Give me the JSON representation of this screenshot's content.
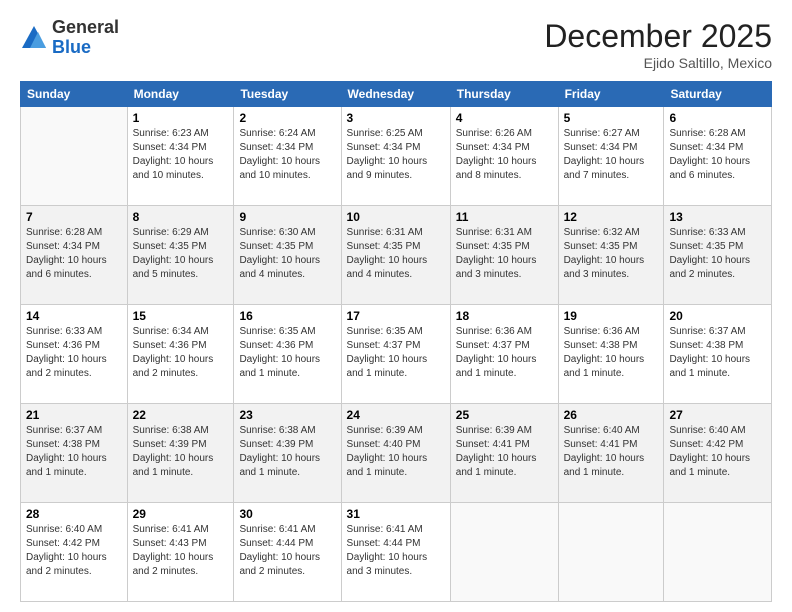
{
  "logo": {
    "general": "General",
    "blue": "Blue"
  },
  "header": {
    "month": "December 2025",
    "location": "Ejido Saltillo, Mexico"
  },
  "weekdays": [
    "Sunday",
    "Monday",
    "Tuesday",
    "Wednesday",
    "Thursday",
    "Friday",
    "Saturday"
  ],
  "weeks": [
    [
      {
        "day": "",
        "info": ""
      },
      {
        "day": "1",
        "info": "Sunrise: 6:23 AM\nSunset: 4:34 PM\nDaylight: 10 hours and 10 minutes."
      },
      {
        "day": "2",
        "info": "Sunrise: 6:24 AM\nSunset: 4:34 PM\nDaylight: 10 hours and 10 minutes."
      },
      {
        "day": "3",
        "info": "Sunrise: 6:25 AM\nSunset: 4:34 PM\nDaylight: 10 hours and 9 minutes."
      },
      {
        "day": "4",
        "info": "Sunrise: 6:26 AM\nSunset: 4:34 PM\nDaylight: 10 hours and 8 minutes."
      },
      {
        "day": "5",
        "info": "Sunrise: 6:27 AM\nSunset: 4:34 PM\nDaylight: 10 hours and 7 minutes."
      },
      {
        "day": "6",
        "info": "Sunrise: 6:28 AM\nSunset: 4:34 PM\nDaylight: 10 hours and 6 minutes."
      }
    ],
    [
      {
        "day": "7",
        "info": "Sunrise: 6:28 AM\nSunset: 4:34 PM\nDaylight: 10 hours and 6 minutes."
      },
      {
        "day": "8",
        "info": "Sunrise: 6:29 AM\nSunset: 4:35 PM\nDaylight: 10 hours and 5 minutes."
      },
      {
        "day": "9",
        "info": "Sunrise: 6:30 AM\nSunset: 4:35 PM\nDaylight: 10 hours and 4 minutes."
      },
      {
        "day": "10",
        "info": "Sunrise: 6:31 AM\nSunset: 4:35 PM\nDaylight: 10 hours and 4 minutes."
      },
      {
        "day": "11",
        "info": "Sunrise: 6:31 AM\nSunset: 4:35 PM\nDaylight: 10 hours and 3 minutes."
      },
      {
        "day": "12",
        "info": "Sunrise: 6:32 AM\nSunset: 4:35 PM\nDaylight: 10 hours and 3 minutes."
      },
      {
        "day": "13",
        "info": "Sunrise: 6:33 AM\nSunset: 4:35 PM\nDaylight: 10 hours and 2 minutes."
      }
    ],
    [
      {
        "day": "14",
        "info": "Sunrise: 6:33 AM\nSunset: 4:36 PM\nDaylight: 10 hours and 2 minutes."
      },
      {
        "day": "15",
        "info": "Sunrise: 6:34 AM\nSunset: 4:36 PM\nDaylight: 10 hours and 2 minutes."
      },
      {
        "day": "16",
        "info": "Sunrise: 6:35 AM\nSunset: 4:36 PM\nDaylight: 10 hours and 1 minute."
      },
      {
        "day": "17",
        "info": "Sunrise: 6:35 AM\nSunset: 4:37 PM\nDaylight: 10 hours and 1 minute."
      },
      {
        "day": "18",
        "info": "Sunrise: 6:36 AM\nSunset: 4:37 PM\nDaylight: 10 hours and 1 minute."
      },
      {
        "day": "19",
        "info": "Sunrise: 6:36 AM\nSunset: 4:38 PM\nDaylight: 10 hours and 1 minute."
      },
      {
        "day": "20",
        "info": "Sunrise: 6:37 AM\nSunset: 4:38 PM\nDaylight: 10 hours and 1 minute."
      }
    ],
    [
      {
        "day": "21",
        "info": "Sunrise: 6:37 AM\nSunset: 4:38 PM\nDaylight: 10 hours and 1 minute."
      },
      {
        "day": "22",
        "info": "Sunrise: 6:38 AM\nSunset: 4:39 PM\nDaylight: 10 hours and 1 minute."
      },
      {
        "day": "23",
        "info": "Sunrise: 6:38 AM\nSunset: 4:39 PM\nDaylight: 10 hours and 1 minute."
      },
      {
        "day": "24",
        "info": "Sunrise: 6:39 AM\nSunset: 4:40 PM\nDaylight: 10 hours and 1 minute."
      },
      {
        "day": "25",
        "info": "Sunrise: 6:39 AM\nSunset: 4:41 PM\nDaylight: 10 hours and 1 minute."
      },
      {
        "day": "26",
        "info": "Sunrise: 6:40 AM\nSunset: 4:41 PM\nDaylight: 10 hours and 1 minute."
      },
      {
        "day": "27",
        "info": "Sunrise: 6:40 AM\nSunset: 4:42 PM\nDaylight: 10 hours and 1 minute."
      }
    ],
    [
      {
        "day": "28",
        "info": "Sunrise: 6:40 AM\nSunset: 4:42 PM\nDaylight: 10 hours and 2 minutes."
      },
      {
        "day": "29",
        "info": "Sunrise: 6:41 AM\nSunset: 4:43 PM\nDaylight: 10 hours and 2 minutes."
      },
      {
        "day": "30",
        "info": "Sunrise: 6:41 AM\nSunset: 4:44 PM\nDaylight: 10 hours and 2 minutes."
      },
      {
        "day": "31",
        "info": "Sunrise: 6:41 AM\nSunset: 4:44 PM\nDaylight: 10 hours and 3 minutes."
      },
      {
        "day": "",
        "info": ""
      },
      {
        "day": "",
        "info": ""
      },
      {
        "day": "",
        "info": ""
      }
    ]
  ]
}
